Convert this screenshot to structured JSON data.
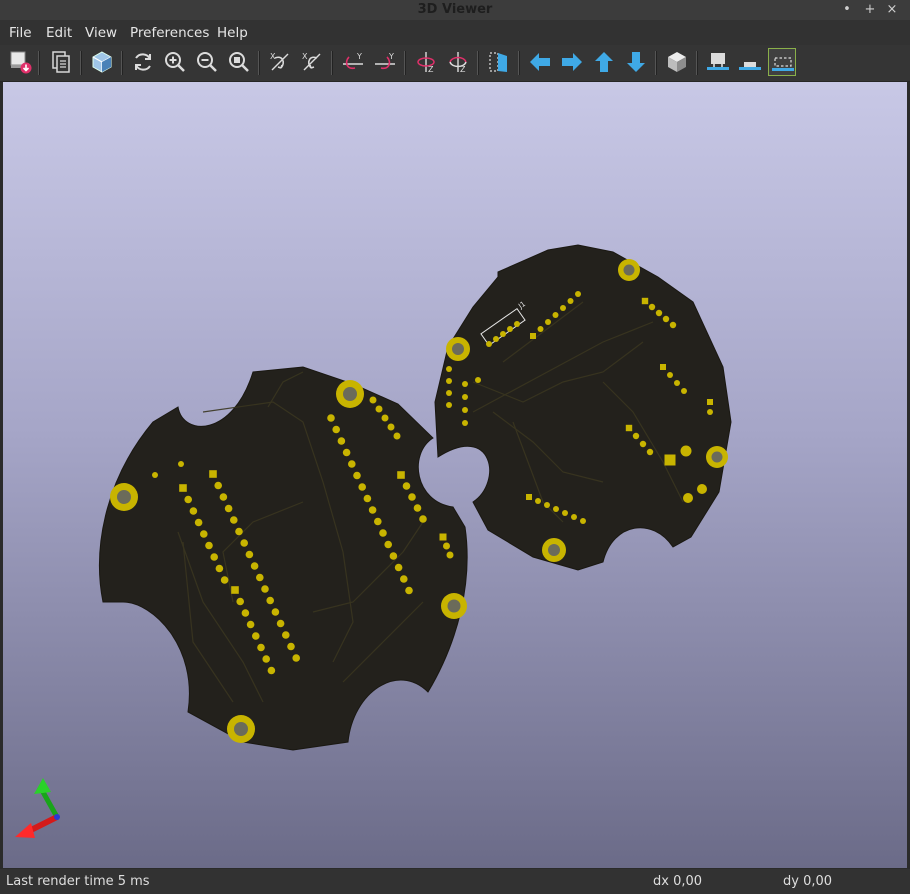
{
  "window": {
    "title": "3D Viewer",
    "minimize": "•",
    "maximize": "+",
    "close": "×"
  },
  "menu": {
    "items": [
      "File",
      "Edit",
      "View",
      "Preferences",
      "Help"
    ]
  },
  "toolbar": {
    "buttons": [
      "export-image-icon",
      "copy-clipboard-icon",
      "raytracing-icon",
      "reload-icon",
      "zoom-in-icon",
      "zoom-out-icon",
      "zoom-fit-icon",
      "rotate-x-cw-icon",
      "rotate-x-ccw-icon",
      "rotate-y-cw-icon",
      "rotate-y-ccw-icon",
      "rotate-z-cw-icon",
      "rotate-z-ccw-icon",
      "flip-board-icon",
      "pan-left-icon",
      "pan-right-icon",
      "pan-up-icon",
      "pan-down-icon",
      "ortho-icon",
      "toggle-tht-icon",
      "toggle-smd-icon",
      "toggle-virtual-icon"
    ],
    "accent_arrow": "#3fa9e6",
    "active_border": "#8ab04a"
  },
  "viewport": {
    "bg_top": "#c8c8e6",
    "bg_bottom": "#6b6b88",
    "board_color": "#23211c",
    "copper_color": "#c8b400",
    "silk_label": "J1"
  },
  "status": {
    "render_time": "Last render time 5 ms",
    "dx": "dx 0,00",
    "dy": "dy 0,00"
  }
}
